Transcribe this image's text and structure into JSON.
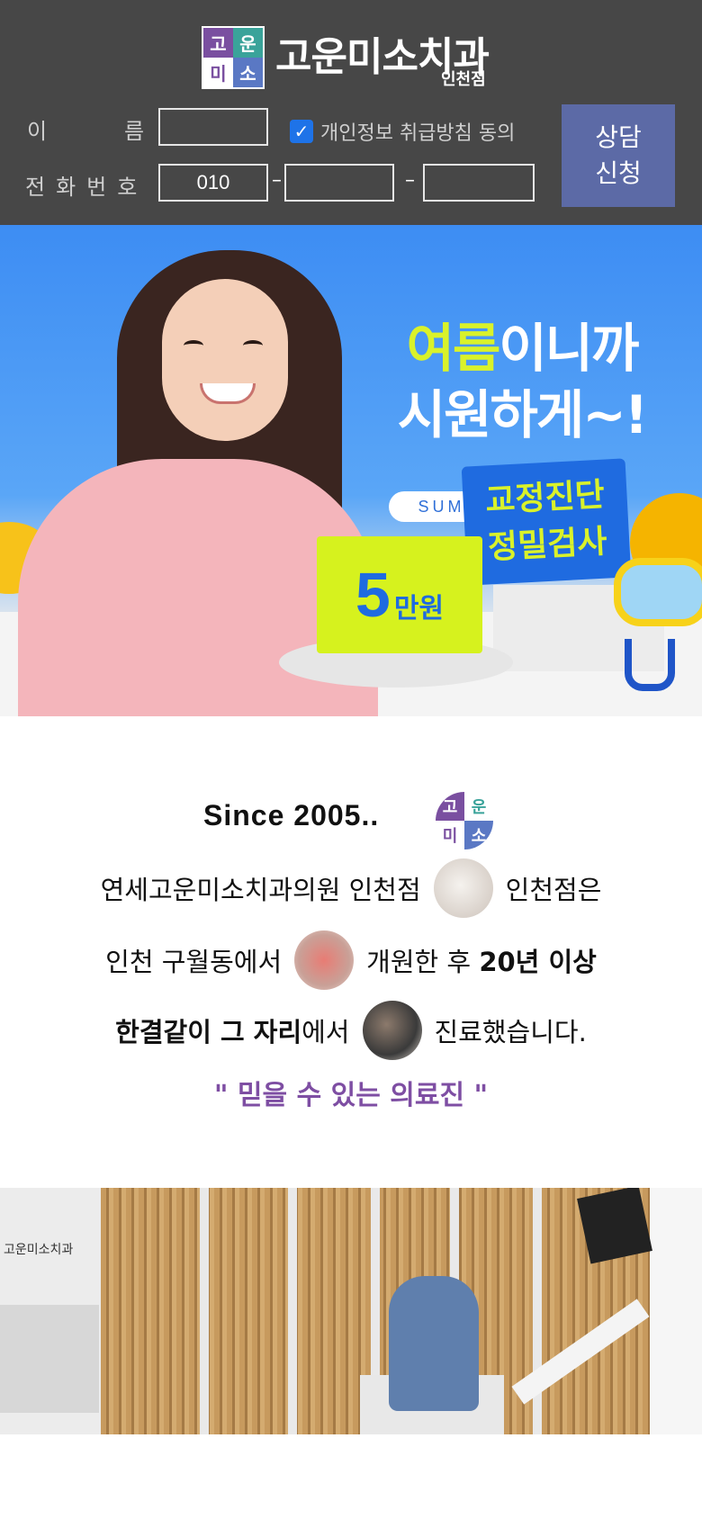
{
  "header": {
    "logo_mark": [
      "고",
      "운",
      "미",
      "소"
    ],
    "logo_text": "고운미소치과",
    "logo_sub": "인천점",
    "name_label_a": "이",
    "name_label_b": "름",
    "phone_label": "전화번호",
    "phone_prefix": "010",
    "dash": "–",
    "agree_label": "개인정보 취급방침 동의",
    "agree_checked": true,
    "submit_line1": "상담",
    "submit_line2": "신청",
    "colors": {
      "header_bg": "#474747",
      "submit_bg": "#5c6aa6",
      "checkbox": "#1e73e8"
    }
  },
  "banner": {
    "pill": "SUMMER EVENT",
    "headline_highlight": "여름",
    "headline_rest1": "이니까",
    "headline_line2": "시원하게~!",
    "box_line1": "교정진단",
    "box_line2": "정밀검사",
    "price_number": "5",
    "price_unit": "만원",
    "colors": {
      "accent_lime": "#d9f22a",
      "accent_blue": "#1f6be0"
    }
  },
  "intro": {
    "since": "Since 2005..",
    "mini_logo": [
      "고",
      "운",
      "미",
      "소"
    ],
    "line1_a": "연세고운미소치과의원 인천점",
    "line1_b": "인천점은",
    "line2_a": "인천 구월동에서",
    "line2_b": "개원한 후",
    "line2_c": "20년 이상",
    "line3_a": "한결같이 그 자리",
    "line3_b": "에서",
    "line3_c": "진료했습니다.",
    "quote": "\" 믿을 수 있는 의료진 \"",
    "colors": {
      "quote": "#7e4ea3"
    }
  },
  "clinic": {
    "lobby_sign": "고운미소치과"
  }
}
